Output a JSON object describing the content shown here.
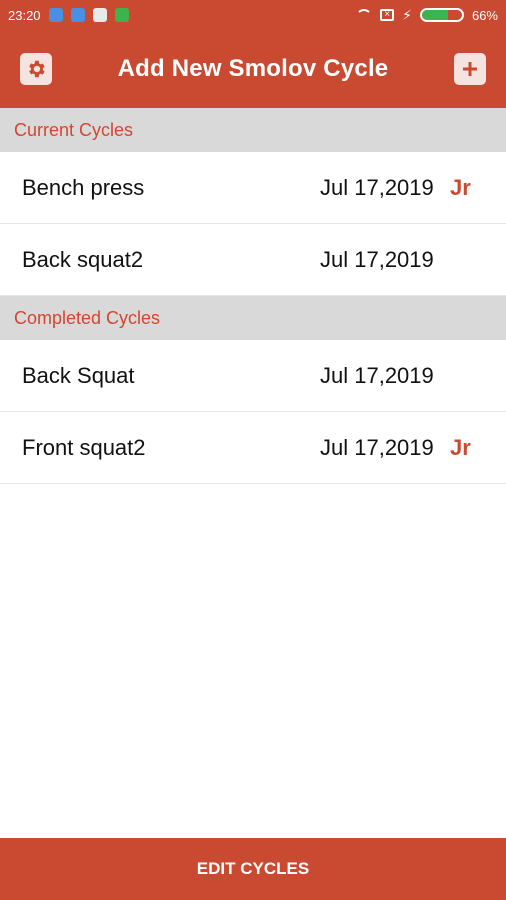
{
  "status_bar": {
    "time": "23:20",
    "battery_percent_text": "66%",
    "battery_level": 0.66
  },
  "toolbar": {
    "title": "Add New Smolov Cycle"
  },
  "sections": {
    "current": {
      "label": "Current Cycles"
    },
    "completed": {
      "label": "Completed Cycles"
    }
  },
  "current_cycles": [
    {
      "name": "Bench press",
      "date": "Jul 17,2019",
      "badge": "Jr"
    },
    {
      "name": "Back squat2",
      "date": "Jul 17,2019",
      "badge": ""
    }
  ],
  "completed_cycles": [
    {
      "name": "Back Squat",
      "date": "Jul 17,2019",
      "badge": ""
    },
    {
      "name": "Front squat2",
      "date": "Jul 17,2019",
      "badge": "Jr"
    }
  ],
  "footer": {
    "edit_label": "EDIT CYCLES"
  },
  "colors": {
    "brand": "#c94a31",
    "section_bg": "#d9d9d9",
    "section_text": "#d2472f"
  },
  "icons": {
    "settings": "gear-icon",
    "add": "plus-icon"
  }
}
